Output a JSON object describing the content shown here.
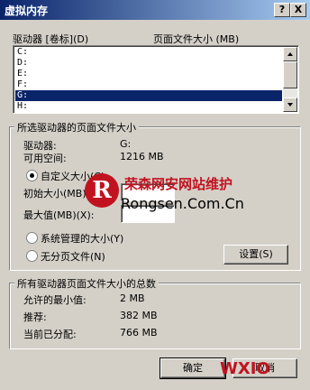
{
  "window": {
    "title": "虚拟内存",
    "help_button": "?",
    "close_button": "X"
  },
  "drives_header": {
    "drive_label": "驱动器 [卷标](D)",
    "paging_size_label": "页面文件大小 (MB)"
  },
  "drives": [
    {
      "letter": "C:",
      "selected": false
    },
    {
      "letter": "D:",
      "selected": false
    },
    {
      "letter": "E:",
      "selected": false
    },
    {
      "letter": "F:",
      "selected": false
    },
    {
      "letter": "G:",
      "selected": true
    },
    {
      "letter": "H:",
      "selected": false
    }
  ],
  "selected_drive_group": {
    "title": "所选驱动器的页面文件大小",
    "drive_label": "驱动器:",
    "drive_value": "G:",
    "free_space_label": "可用空间:",
    "free_space_value": "1216 MB",
    "custom_size_label": "自定义大小(C):",
    "initial_size_label": "初始大小(MB)",
    "initial_size_value": "",
    "max_size_label": "最大值(MB)(X):",
    "max_size_value": "",
    "system_managed_label": "系统管理的大小(Y)",
    "no_paging_label": "无分页文件(N)",
    "set_button": "设置(S)",
    "selected_option": "custom"
  },
  "total_group": {
    "title": "所有驱动器页面文件大小的总数",
    "min_allowed_label": "允许的最小值:",
    "min_allowed_value": "2 MB",
    "recommended_label": "推荐:",
    "recommended_value": "382 MB",
    "currently_allocated_label": "当前已分配:",
    "currently_allocated_value": "766 MB"
  },
  "buttons": {
    "ok": "确定",
    "cancel": "取消"
  },
  "watermark": {
    "logo_letter": "R",
    "brand_cn": "荣森网安网站维护",
    "brand_url": "Rongsen.Com.Cn",
    "corner": "WXIO"
  },
  "colors": {
    "titlebar_start": "#0a246a",
    "titlebar_end": "#a6caf0",
    "selection": "#0a246a",
    "dialog_bg": "#d4d0c8",
    "watermark_red": "#c1121f"
  }
}
